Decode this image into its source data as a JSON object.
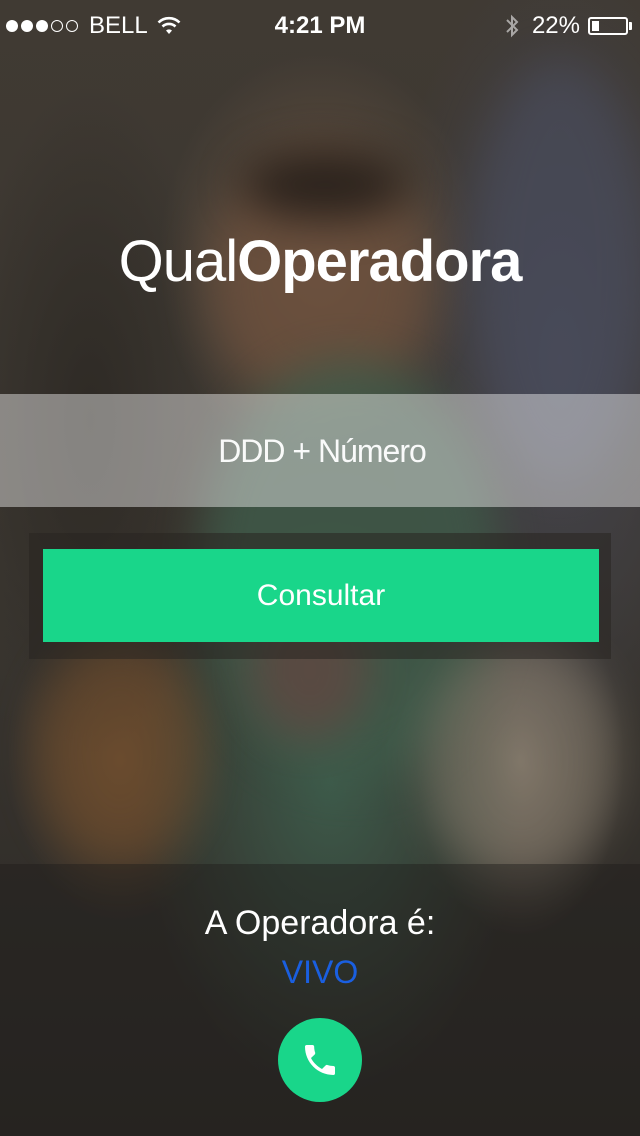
{
  "status_bar": {
    "carrier": "BELL",
    "time": "4:21 PM",
    "battery_percent": "22%",
    "battery_level": 0.22,
    "signal_bars_filled": 3,
    "signal_bars_total": 5
  },
  "logo": {
    "light": "Qual",
    "bold": "Operadora"
  },
  "search": {
    "placeholder": "DDD + Número",
    "value": ""
  },
  "actions": {
    "consult_label": "Consultar"
  },
  "result": {
    "label": "A Operadora é:",
    "value": "VIVO"
  },
  "colors": {
    "accent": "#19d68a",
    "result_value": "#1a5fe0"
  }
}
